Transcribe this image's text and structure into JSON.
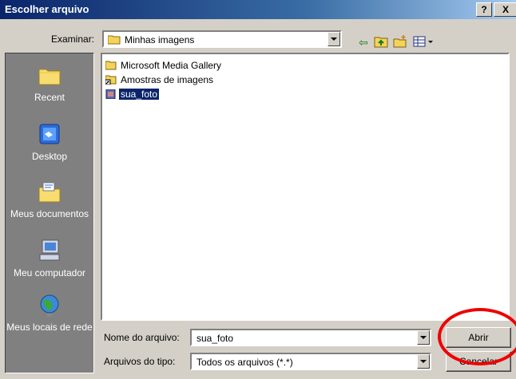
{
  "window": {
    "title": "Escolher arquivo",
    "help_label": "?",
    "close_label": "X"
  },
  "toolbar": {
    "look_in_label": "Examinar:",
    "look_in_value": "Minhas imagens"
  },
  "places": [
    {
      "label": "Recent",
      "icon": "recent-folder-icon"
    },
    {
      "label": "Desktop",
      "icon": "desktop-icon"
    },
    {
      "label": "Meus documentos",
      "icon": "my-documents-icon"
    },
    {
      "label": "Meu computador",
      "icon": "my-computer-icon"
    },
    {
      "label": "Meus locais de rede",
      "icon": "network-places-icon"
    }
  ],
  "files": [
    {
      "name": "Microsoft Media Gallery",
      "icon": "folder-icon",
      "selected": false
    },
    {
      "name": "Amostras de imagens",
      "icon": "folder-shortcut-icon",
      "selected": false
    },
    {
      "name": "sua_foto",
      "icon": "image-file-icon",
      "selected": true
    }
  ],
  "form": {
    "filename_label": "Nome do arquivo:",
    "filename_value": "sua_foto",
    "filetype_label": "Arquivos do tipo:",
    "filetype_value": "Todos os arquivos (*.*)"
  },
  "buttons": {
    "open": "Abrir",
    "cancel": "Cancelar"
  },
  "colors": {
    "title_bar": "#0a246a",
    "places_bar": "#808080",
    "selection": "#0a246a",
    "highlight_circle": "#e00000"
  }
}
